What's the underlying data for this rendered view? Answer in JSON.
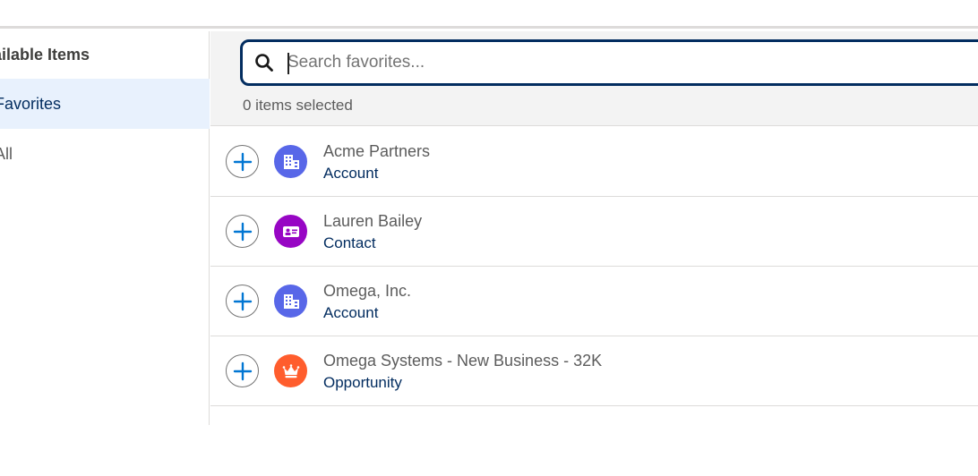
{
  "sidebar": {
    "heading": "vailable Items",
    "items": [
      {
        "label": "Favorites",
        "active": true
      },
      {
        "label": "All",
        "active": false
      }
    ]
  },
  "search": {
    "placeholder": "Search favorites...",
    "value": ""
  },
  "selection": {
    "count_text": "0 items selected"
  },
  "results": [
    {
      "title": "Acme Partners",
      "type": "Account",
      "icon": "account-building-icon",
      "icon_color": "#5867e8"
    },
    {
      "title": "Lauren Bailey",
      "type": "Contact",
      "icon": "contact-card-icon",
      "icon_color": "#9706c4"
    },
    {
      "title": "Omega, Inc.",
      "type": "Account",
      "icon": "account-building-icon",
      "icon_color": "#5867e8"
    },
    {
      "title": "Omega Systems - New Business - 32K",
      "type": "Opportunity",
      "icon": "opportunity-crown-icon",
      "icon_color": "#ff5d2d"
    }
  ],
  "colors": {
    "accent_dark": "#032d60",
    "active_bg": "#e8f1fd",
    "add_plus": "#0176d3"
  }
}
